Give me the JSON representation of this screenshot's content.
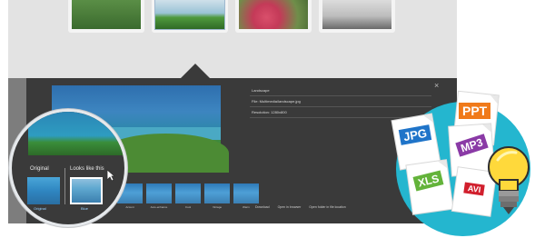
{
  "viewer": {
    "panel_title": "Landscape",
    "file_row": "File: Multimedia/landscape.jpg",
    "resolution_row": "Resolution: 1280x800",
    "close_glyph": "×",
    "actions": [
      "Download",
      "Open in browser",
      "Open folder in file location"
    ]
  },
  "filters": [
    {
      "label": "Accent"
    },
    {
      "label": "Auto-enhance"
    },
    {
      "label": "Cool"
    },
    {
      "label": "Vintage"
    },
    {
      "label": "Warm"
    }
  ],
  "magnifier": {
    "label_original": "Original",
    "label_looks_like": "Looks like this",
    "caption_original": "Original",
    "caption_selected": "Blue"
  },
  "file_types": {
    "jpg": "JPG",
    "ppt": "PPT",
    "mp3": "MP3",
    "xls": "XLS",
    "avi": "AVI",
    "colors": {
      "jpg": "#1f74c9",
      "ppt": "#f07a1a",
      "mp3": "#8a3aa6",
      "xls": "#63b33a",
      "avi": "#d11f2d"
    }
  },
  "icons": [
    "cursor-icon",
    "lightbulb-icon",
    "close-icon",
    "file-icon"
  ]
}
